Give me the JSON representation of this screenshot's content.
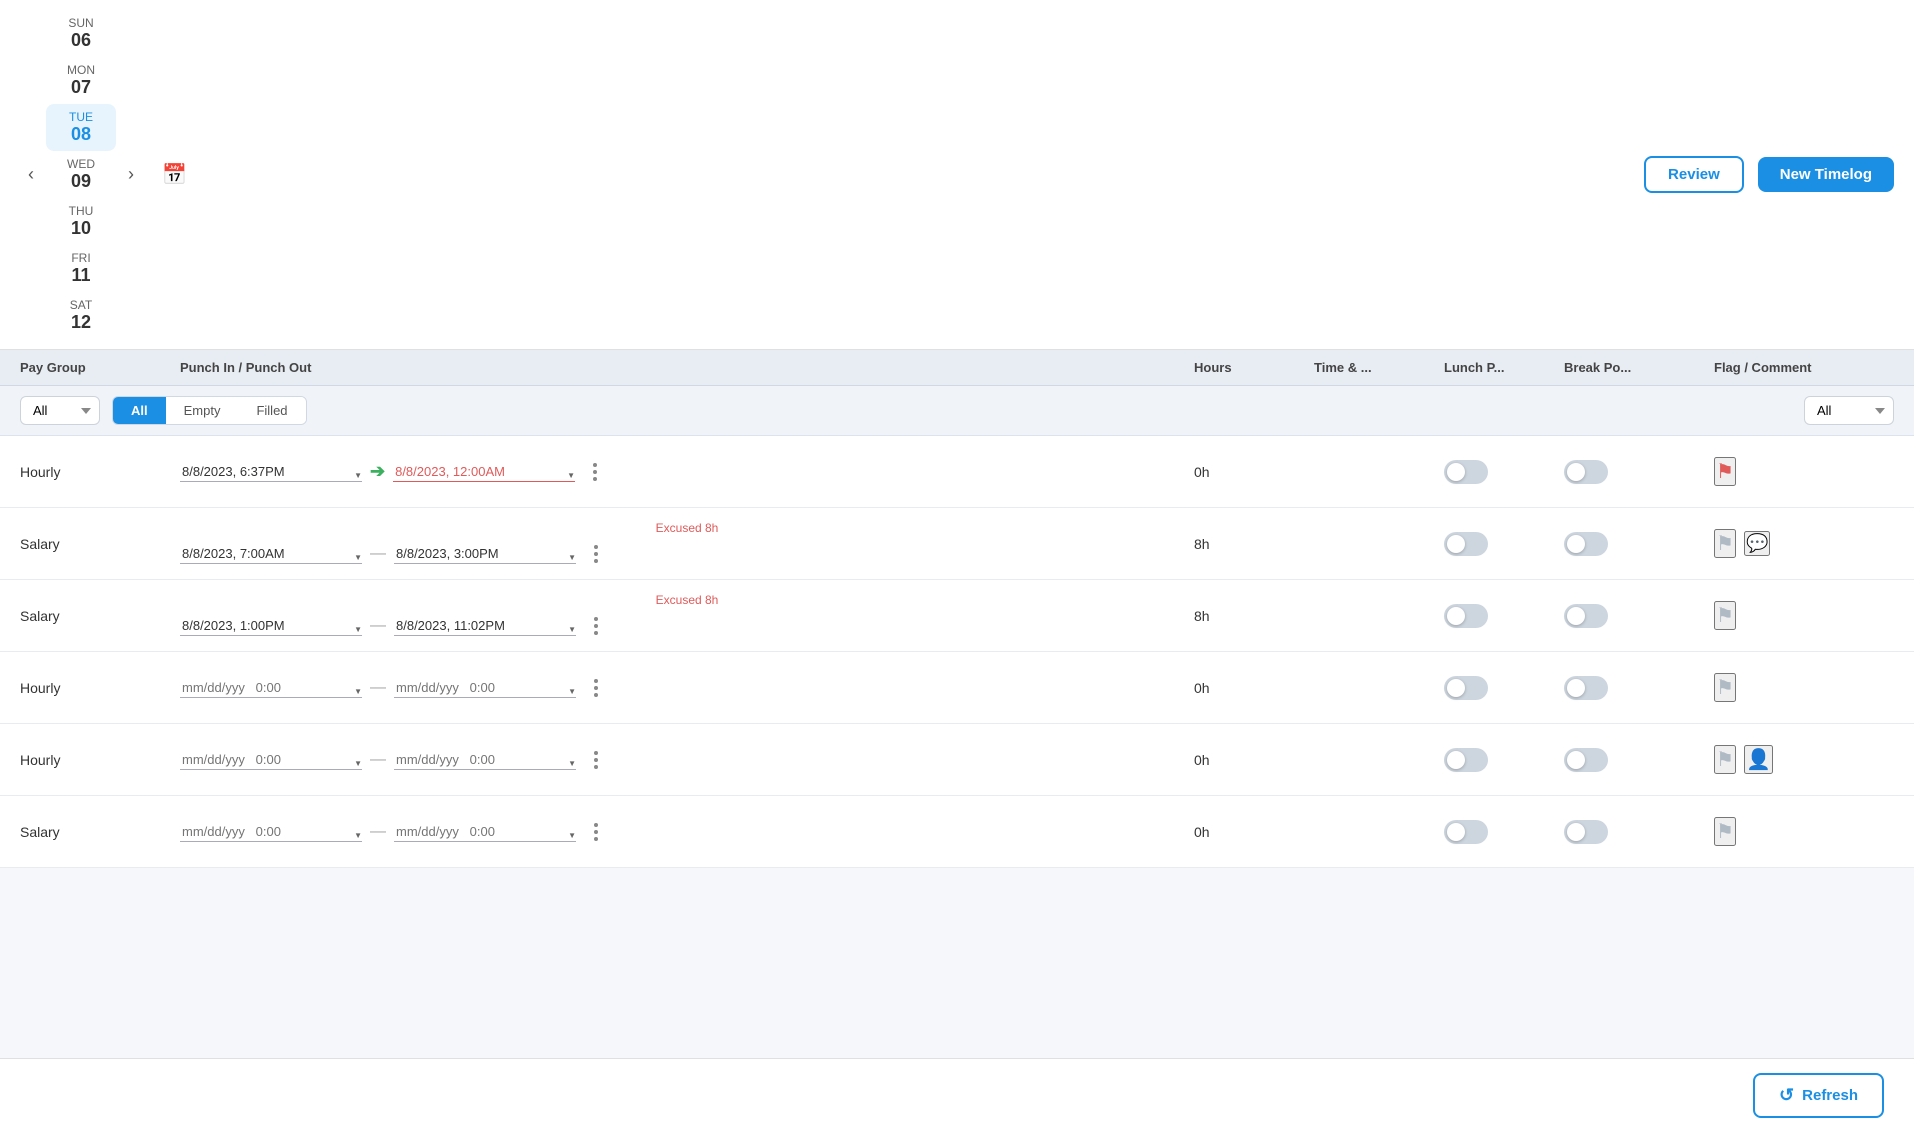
{
  "nav": {
    "prev_arrow": "‹",
    "next_arrow": "›",
    "days": [
      {
        "name": "SUN",
        "num": "06",
        "active": false
      },
      {
        "name": "MON",
        "num": "07",
        "active": false
      },
      {
        "name": "TUE",
        "num": "08",
        "active": true
      },
      {
        "name": "WED",
        "num": "09",
        "active": false
      },
      {
        "name": "THU",
        "num": "10",
        "active": false
      },
      {
        "name": "FRI",
        "num": "11",
        "active": false
      },
      {
        "name": "SAT",
        "num": "12",
        "active": false
      }
    ],
    "review_label": "Review",
    "new_timelog_label": "New Timelog"
  },
  "columns": {
    "pay_group": "Pay Group",
    "punch_in_out": "Punch In / Punch Out",
    "hours": "Hours",
    "time_attendance": "Time & ...",
    "lunch_period": "Lunch P...",
    "break_policy": "Break Po...",
    "flag_comment": "Flag / Comment"
  },
  "filters": {
    "pay_group_options": [
      "All"
    ],
    "pay_group_selected": "All",
    "toggle_options": [
      "All",
      "Empty",
      "Filled"
    ],
    "toggle_selected": "All",
    "flag_options": [
      "All"
    ],
    "flag_selected": "All"
  },
  "rows": [
    {
      "pay_group": "Hourly",
      "excused": null,
      "punch_in": "8/8/2023, 6:37PM",
      "punch_in_red": false,
      "punch_out": "8/8/2023, 12:00AM",
      "punch_out_red": true,
      "arrow": true,
      "dash": false,
      "hours": "0h",
      "lunch_toggle": false,
      "break_toggle": false,
      "flag_red": true,
      "person": false,
      "chat": false
    },
    {
      "pay_group": "Salary",
      "excused": "Excused 8h",
      "punch_in": "8/8/2023, 7:00AM",
      "punch_in_red": false,
      "punch_out": "8/8/2023, 3:00PM",
      "punch_out_red": false,
      "arrow": false,
      "dash": true,
      "hours": "8h",
      "lunch_toggle": false,
      "break_toggle": false,
      "flag_red": false,
      "person": false,
      "chat": true
    },
    {
      "pay_group": "Salary",
      "excused": "Excused 8h",
      "punch_in": "8/8/2023, 1:00PM",
      "punch_in_red": false,
      "punch_out": "8/8/2023, 11:02PM",
      "punch_out_red": false,
      "arrow": false,
      "dash": true,
      "hours": "8h",
      "lunch_toggle": false,
      "break_toggle": false,
      "flag_red": false,
      "person": false,
      "chat": false
    },
    {
      "pay_group": "Hourly",
      "excused": null,
      "punch_in": "",
      "punch_in_placeholder": "mm/dd/yyy   0:00",
      "punch_in_red": false,
      "punch_out": "",
      "punch_out_placeholder": "mm/dd/yyy   0:00",
      "punch_out_red": false,
      "arrow": false,
      "dash": true,
      "hours": "0h",
      "lunch_toggle": false,
      "break_toggle": false,
      "flag_red": false,
      "person": false,
      "chat": false
    },
    {
      "pay_group": "Hourly",
      "excused": null,
      "punch_in": "",
      "punch_in_placeholder": "mm/dd/yyy   0:00",
      "punch_in_red": false,
      "punch_out": "",
      "punch_out_placeholder": "mm/dd/yyy   0:00",
      "punch_out_red": false,
      "arrow": false,
      "dash": true,
      "hours": "0h",
      "lunch_toggle": false,
      "break_toggle": false,
      "flag_red": false,
      "person": true,
      "chat": false
    },
    {
      "pay_group": "Salary",
      "excused": null,
      "punch_in": "",
      "punch_in_placeholder": "mm/dd/yyy   0:00",
      "punch_in_red": false,
      "punch_out": "",
      "punch_out_placeholder": "mm/dd/yyy   0:00",
      "punch_out_red": false,
      "arrow": false,
      "dash": true,
      "hours": "0h",
      "lunch_toggle": false,
      "break_toggle": false,
      "flag_red": false,
      "person": false,
      "chat": false
    }
  ],
  "bottom": {
    "refresh_label": "Refresh"
  }
}
